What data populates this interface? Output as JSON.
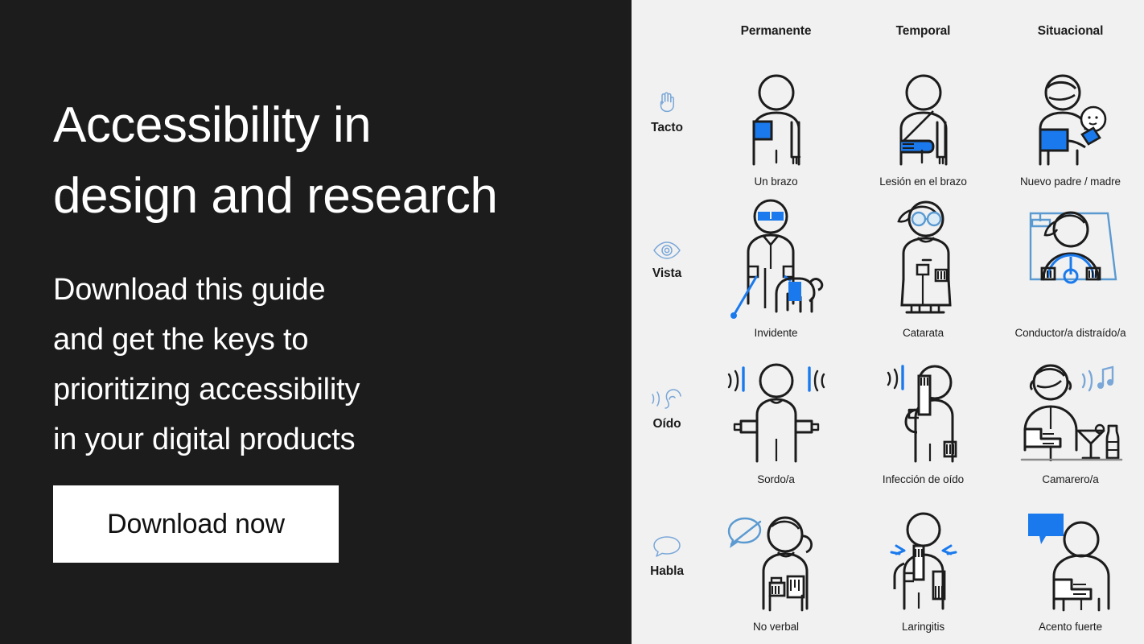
{
  "promo": {
    "headline": "Accessibility in\ndesign and research",
    "subcopy": "Download this guide\nand get the keys to\nprioritizing accessibility\nin your digital products",
    "cta_label": "Download now",
    "background_color": "#1c1c1c",
    "text_color": "#ffffff",
    "cta_background": "#ffffff",
    "cta_text_color": "#111111"
  },
  "matrix": {
    "accent_color": "#1a7aed",
    "panel_background": "#f1f1f1",
    "ink_color": "#1c1c1c",
    "columns": [
      {
        "label": "Permanente"
      },
      {
        "label": "Temporal"
      },
      {
        "label": "Situacional"
      }
    ],
    "rows": [
      {
        "label": "Tacto",
        "icon": "hand-icon",
        "cells": [
          {
            "caption": "Un brazo",
            "art": "one-arm-figure-illustration"
          },
          {
            "caption": "Lesión en el brazo",
            "art": "arm-in-sling-illustration"
          },
          {
            "caption": "Nuevo padre / madre",
            "art": "parent-holding-baby-illustration"
          }
        ]
      },
      {
        "label": "Vista",
        "icon": "eye-icon",
        "cells": [
          {
            "caption": "Invidente",
            "art": "blind-person-with-guide-dog-illustration"
          },
          {
            "caption": "Catarata",
            "art": "person-with-cataract-glasses-illustration"
          },
          {
            "caption": "Conductor/a distraído/a",
            "art": "distracted-driver-illustration"
          }
        ]
      },
      {
        "label": "Oído",
        "icon": "ear-with-soundwaves-icon",
        "cells": [
          {
            "caption": "Sordo/a",
            "art": "deaf-person-signing-illustration"
          },
          {
            "caption": "Infección de oído",
            "art": "person-with-ear-infection-illustration"
          },
          {
            "caption": "Camarero/a",
            "art": "bartender-in-noisy-bar-illustration"
          }
        ]
      },
      {
        "label": "Habla",
        "icon": "speech-bubble-icon",
        "cells": [
          {
            "caption": "No verbal",
            "art": "nonverbal-person-with-device-illustration"
          },
          {
            "caption": "Laringitis",
            "art": "person-with-laryngitis-illustration"
          },
          {
            "caption": "Acento fuerte",
            "art": "person-with-strong-accent-illustration"
          }
        ]
      }
    ]
  }
}
